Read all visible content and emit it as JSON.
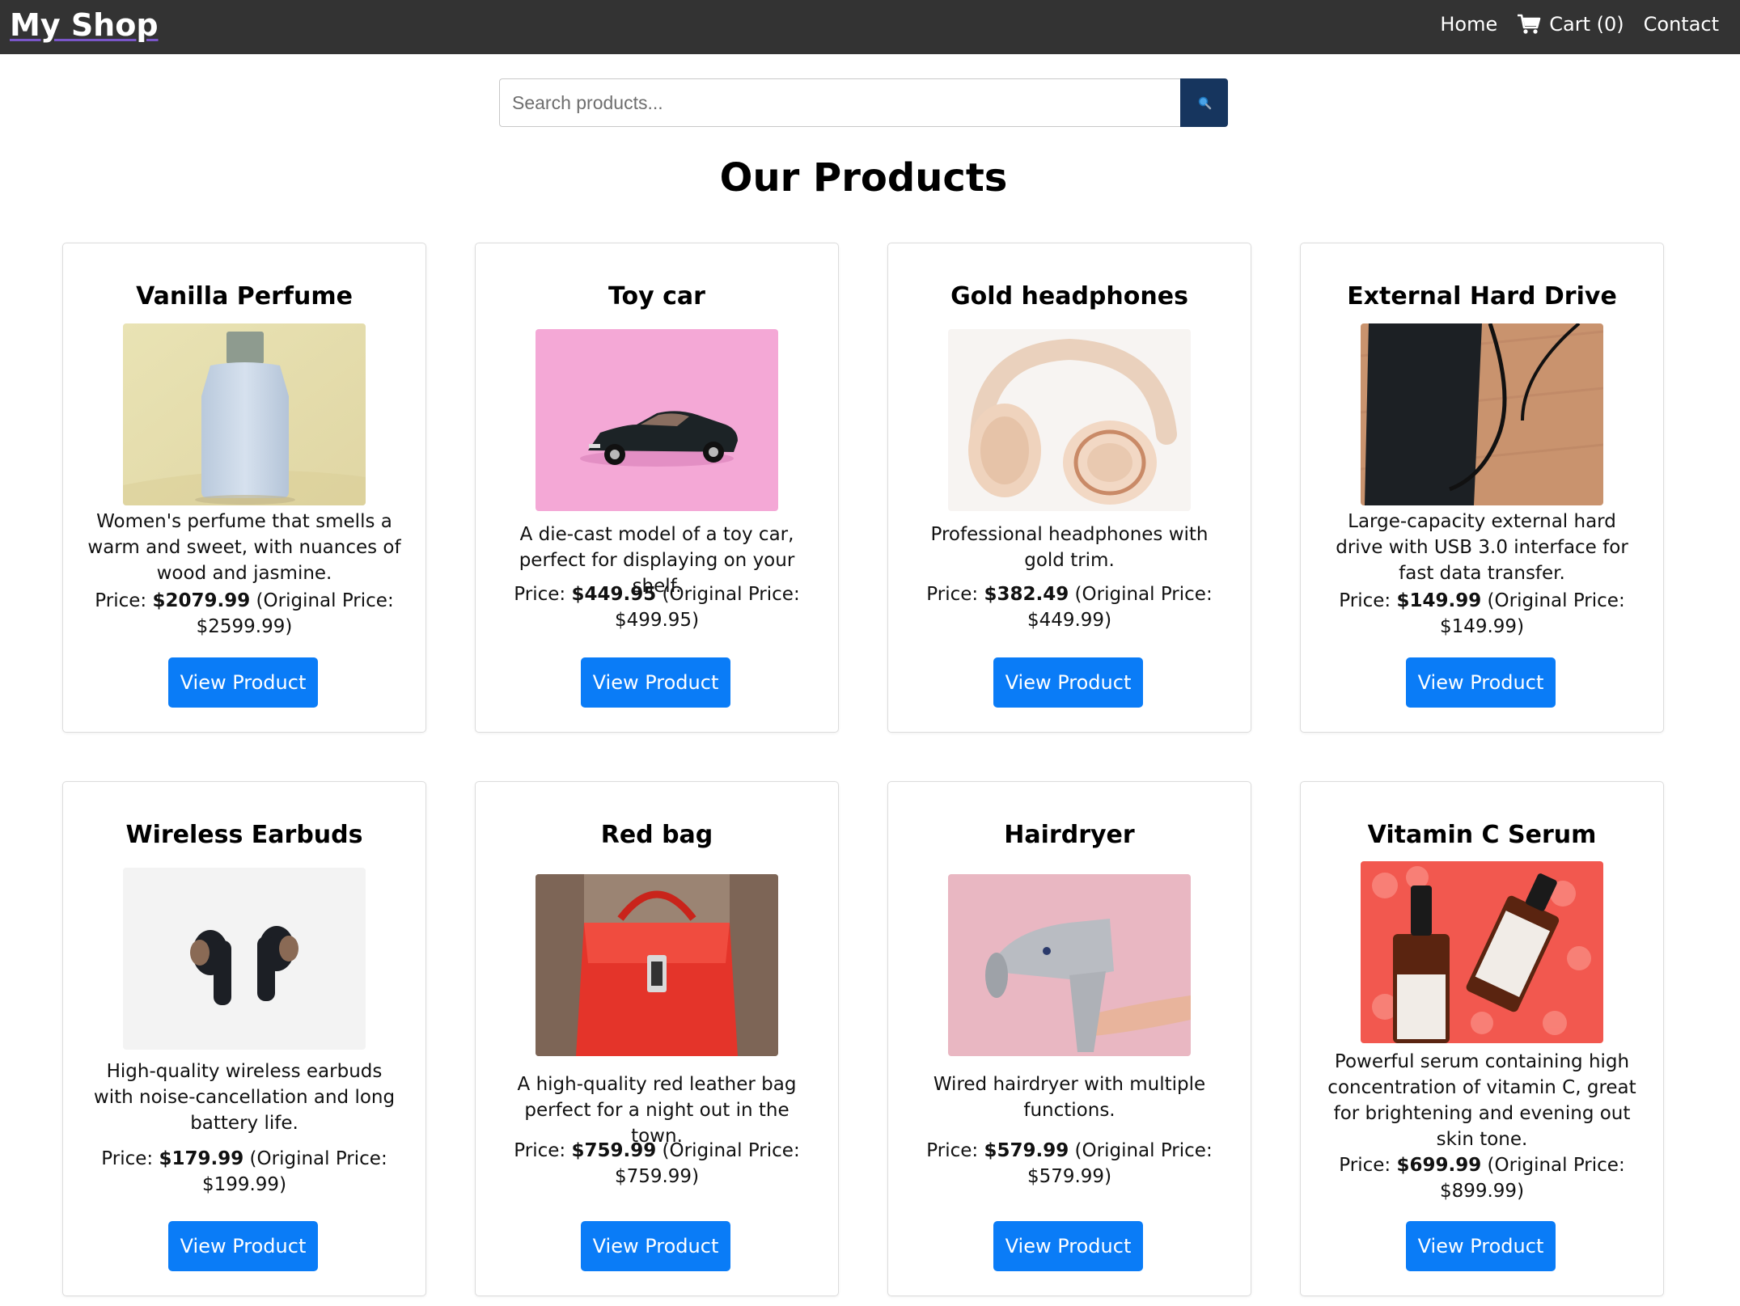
{
  "header": {
    "brand": "My Shop",
    "nav": {
      "home": "Home",
      "cart": "Cart (0)",
      "contact": "Contact"
    }
  },
  "search": {
    "placeholder": "Search products...",
    "value": "",
    "button_icon": "search-icon"
  },
  "main": {
    "title": "Our Products",
    "products": [
      {
        "name": "Vanilla Perfume",
        "image": "perfume-bottle",
        "description": "Women's perfume that smells a warm and sweet, with nuances of wood and jasmine.",
        "price_label": "Price:",
        "price": "$2079.99",
        "original_price": "(Original Price: $2599.99)",
        "button": "View Product"
      },
      {
        "name": "Toy car",
        "image": "toy-car",
        "description": "A die-cast model of a toy car, perfect for displaying on your shelf.",
        "price_label": "Price:",
        "price": "$449.95",
        "original_price": "(Original Price: $499.95)",
        "button": "View Product"
      },
      {
        "name": "Gold headphones",
        "image": "headphones",
        "description": "Professional headphones with gold trim.",
        "price_label": "Price:",
        "price": "$382.49",
        "original_price": "(Original Price: $449.99)",
        "button": "View Product"
      },
      {
        "name": "External Hard Drive",
        "image": "hard-drive",
        "description": "Large-capacity external hard drive with USB 3.0 interface for fast data transfer.",
        "price_label": "Price:",
        "price": "$149.99",
        "original_price": "(Original Price: $149.99)",
        "button": "View Product"
      },
      {
        "name": "Wireless Earbuds",
        "image": "earbuds",
        "description": "High-quality wireless earbuds with noise-cancellation and long battery life.",
        "price_label": "Price:",
        "price": "$179.99",
        "original_price": "(Original Price: $199.99)",
        "button": "View Product"
      },
      {
        "name": "Red bag",
        "image": "red-handbag",
        "description": "A high-quality red leather bag perfect for a night out in the town.",
        "price_label": "Price:",
        "price": "$759.99",
        "original_price": "(Original Price: $759.99)",
        "button": "View Product"
      },
      {
        "name": "Hairdryer",
        "image": "hairdryer",
        "description": "Wired hairdryer with multiple functions.",
        "price_label": "Price:",
        "price": "$579.99",
        "original_price": "(Original Price: $579.99)",
        "button": "View Product"
      },
      {
        "name": "Vitamin C Serum",
        "image": "serum-bottles",
        "description": "Powerful serum containing high concentration of vitamin C, great for brightening and evening out skin tone.",
        "price_label": "Price:",
        "price": "$699.99",
        "original_price": "(Original Price: $899.99)",
        "button": "View Product"
      }
    ]
  },
  "colors": {
    "header_bg": "#333333",
    "button_bg": "#0a7cf7",
    "search_button_bg": "#16355e"
  }
}
